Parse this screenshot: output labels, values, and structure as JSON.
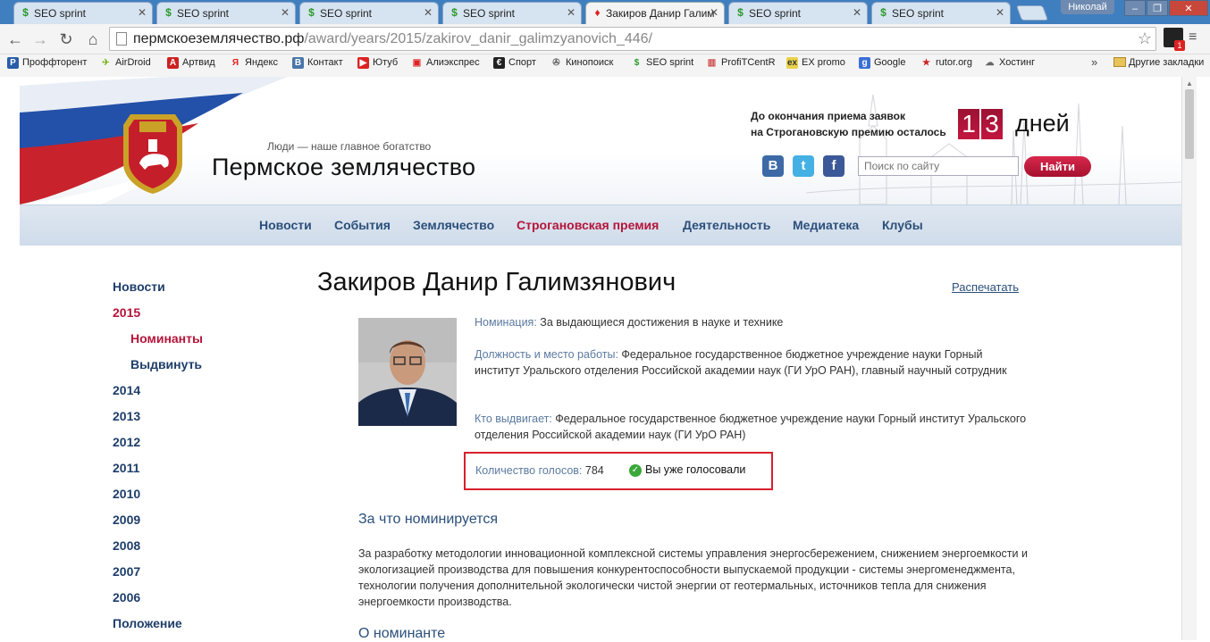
{
  "browser": {
    "tabs": [
      {
        "label": "SEO sprint",
        "active": false
      },
      {
        "label": "SEO sprint",
        "active": false
      },
      {
        "label": "SEO sprint",
        "active": false
      },
      {
        "label": "SEO sprint",
        "active": false
      },
      {
        "label": "Закиров Данир Галим",
        "active": true
      },
      {
        "label": "SEO sprint",
        "active": false
      },
      {
        "label": "SEO sprint",
        "active": false
      }
    ],
    "user": "Николай",
    "url_host": "пермскоеземлячество.рф",
    "url_path": "/award/years/2015/zakirov_danir_galimzyanovich_446/",
    "bookmarks": [
      "Проффторент",
      "AirDroid",
      "Артвид",
      "Яндекс",
      "Контакт",
      "Ютуб",
      "Алиэкспрес",
      "Спорт",
      "Кинопоиск",
      "SEO sprint",
      "ProfiTCentR",
      "EX promo",
      "Google",
      "rutor.org",
      "Хостинг"
    ],
    "other_bookmarks": "Другие закладки",
    "chevron": "»"
  },
  "header": {
    "tagline": "Люди — наше главное богатство",
    "site_name": "Пермское землячество",
    "deadline_line1": "До окончания приема заявок",
    "deadline_line2": "на Строгановскую премию осталось",
    "digit1": "1",
    "digit2": "3",
    "days_label": "дней",
    "search_placeholder": "Поиск по сайту",
    "search_button": "Найти"
  },
  "nav": {
    "items": [
      "Новости",
      "События",
      "Землячество",
      "Строгановская премия",
      "Деятельность",
      "Медиатека",
      "Клубы"
    ]
  },
  "sidebar": {
    "items": [
      "Новости",
      "2015",
      "Номинанты",
      "Выдвинуть",
      "2014",
      "2013",
      "2012",
      "2011",
      "2010",
      "2009",
      "2008",
      "2007",
      "2006",
      "Положение"
    ]
  },
  "main": {
    "title": "Закиров Данир Галимзянович",
    "print_label": "Распечатать",
    "nomination_label": "Номинация:",
    "nomination_value": "За выдающиеся достижения в науке и технике",
    "position_label": "Должность и место работы:",
    "position_value": "Федеральное государственное бюджетное учреждение науки Горный институт Уральского отделения Российской академии наук (ГИ УрО РАН), главный научный сотрудник",
    "nominator_label": "Кто выдвигает:",
    "nominator_value": "Федеральное государственное бюджетное учреждение науки Горный институт Уральского отделения Российской академии наук (ГИ УрО РАН)",
    "votes_label": "Количество голосов:",
    "votes_count": "784",
    "voted_text": "Вы уже голосовали",
    "section1_title": "За что номинируется",
    "section1_text": "За разработку методологии инновационной комплексной системы управления энергосбережением, снижением энергоемкости и экологизацией производства для повышения конкурентоспособности выпускаемой продукции - системы энергоменеджмента, технологии получения дополнительной экологически чистой энергии от геотермальных, источников тепла для снижения энергоемкости производства.",
    "section2_title": "О номинанте"
  },
  "colors": {
    "accent_red": "#b5143a",
    "link_blue": "#2b4f7a",
    "vote_border": "#d8202c"
  }
}
